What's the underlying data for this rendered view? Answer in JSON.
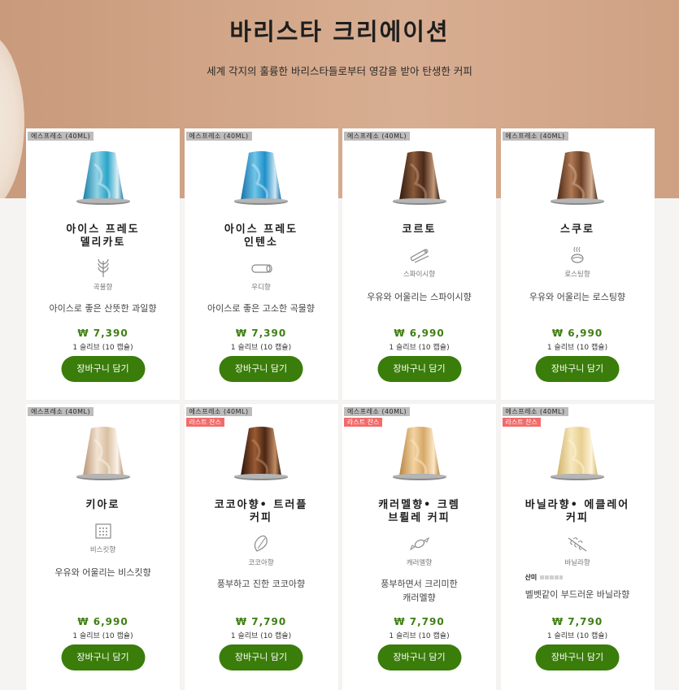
{
  "hero": {
    "title": "바리스타 크리에이션",
    "subtitle": "세계 각지의 훌륭한 바리스타들로부터 영감을 받아 탄생한 커피"
  },
  "colors": {
    "accent_green": "#3a7d0a",
    "price_green": "#3f7f12",
    "last_chance_red": "#f26b6b",
    "tag_gray": "#bdbdbd"
  },
  "products": [
    {
      "tag": "에스프레소 (40ML)",
      "name_line1": "아이스 프레도",
      "name_line2": "델리카토",
      "flavor_icon": "grain-icon",
      "flavor": "곡물향",
      "desc_line1": "아이스로 좋은 산뜻한 과일향",
      "desc_line2": "",
      "price": "₩ 7,390",
      "unit": "1 슬리브 (10 캡슐)",
      "button": "장바구니 담기",
      "last_chance": "",
      "acidity_label": "",
      "capsule": "blue-light"
    },
    {
      "tag": "에스프레소 (40ML)",
      "name_line1": "아이스 프레도",
      "name_line2": "인텐소",
      "flavor_icon": "wood-log-icon",
      "flavor": "우디향",
      "desc_line1": "아이스로 좋은 고소한 곡물향",
      "desc_line2": "",
      "price": "₩ 7,390",
      "unit": "1 슬리브 (10 캡슐)",
      "button": "장바구니 담기",
      "last_chance": "",
      "acidity_label": "",
      "capsule": "blue-dark"
    },
    {
      "tag": "에스프레소 (40ML)",
      "name_line1": "코르토",
      "name_line2": "",
      "flavor_icon": "cinnamon-icon",
      "flavor": "스파이시향",
      "desc_line1": "우유와 어울리는 스파이시향",
      "desc_line2": "",
      "price": "₩ 6,990",
      "unit": "1 슬리브 (10 캡슐)",
      "button": "장바구니 담기",
      "last_chance": "",
      "acidity_label": "",
      "capsule": "brown-dark"
    },
    {
      "tag": "에스프레소 (40ML)",
      "name_line1": "스쿠로",
      "name_line2": "",
      "flavor_icon": "roasted-bean-icon",
      "flavor": "로스팅향",
      "desc_line1": "우유와 어울리는 로스팅향",
      "desc_line2": "",
      "price": "₩ 6,990",
      "unit": "1 슬리브 (10 캡슐)",
      "button": "장바구니 담기",
      "last_chance": "",
      "acidity_label": "",
      "capsule": "brown-medium"
    },
    {
      "tag": "에스프레소 (40ML)",
      "name_line1": "키아로",
      "name_line2": "",
      "flavor_icon": "biscuit-icon",
      "flavor": "비스킷향",
      "desc_line1": "우유와 어울리는 비스킷향",
      "desc_line2": "",
      "price": "₩ 6,990",
      "unit": "1 슬리브 (10 캡슐)",
      "button": "장바구니 담기",
      "last_chance": "",
      "acidity_label": "",
      "capsule": "cream"
    },
    {
      "tag": "에스프레소 (40ML)",
      "name_line1": "코코아향• 트러플",
      "name_line2": "커피",
      "flavor_icon": "cocoa-pod-icon",
      "flavor": "코코아향",
      "desc_line1": "풍부하고 진한 코코아향",
      "desc_line2": "",
      "price": "₩ 7,790",
      "unit": "1 슬리브 (10 캡슐)",
      "button": "장바구니 담기",
      "last_chance": "라스트 찬스",
      "acidity_label": "",
      "capsule": "chocolate"
    },
    {
      "tag": "에스프레소 (40ML)",
      "name_line1": "캐러멜향• 크렘",
      "name_line2": "브륄레 커피",
      "flavor_icon": "caramel-candy-icon",
      "flavor": "캐러멜향",
      "desc_line1": "풍부하면서 크리미한",
      "desc_line2": "캐러멜향",
      "price": "₩ 7,790",
      "unit": "1 슬리브 (10 캡슐)",
      "button": "장바구니 담기",
      "last_chance": "라스트 찬스",
      "acidity_label": "",
      "capsule": "caramel"
    },
    {
      "tag": "에스프레소 (40ML)",
      "name_line1": "바닐라향• 에클레어",
      "name_line2": "커피",
      "flavor_icon": "vanilla-flower-icon",
      "flavor": "바닐라향",
      "desc_line1": "벨벳같이 부드러운 바닐라향",
      "desc_line2": "",
      "price": "₩ 7,790",
      "unit": "1 슬리브 (10 캡슐)",
      "button": "장바구니 담기",
      "last_chance": "라스트 찬스",
      "acidity_label": "산미",
      "capsule": "vanilla"
    }
  ]
}
